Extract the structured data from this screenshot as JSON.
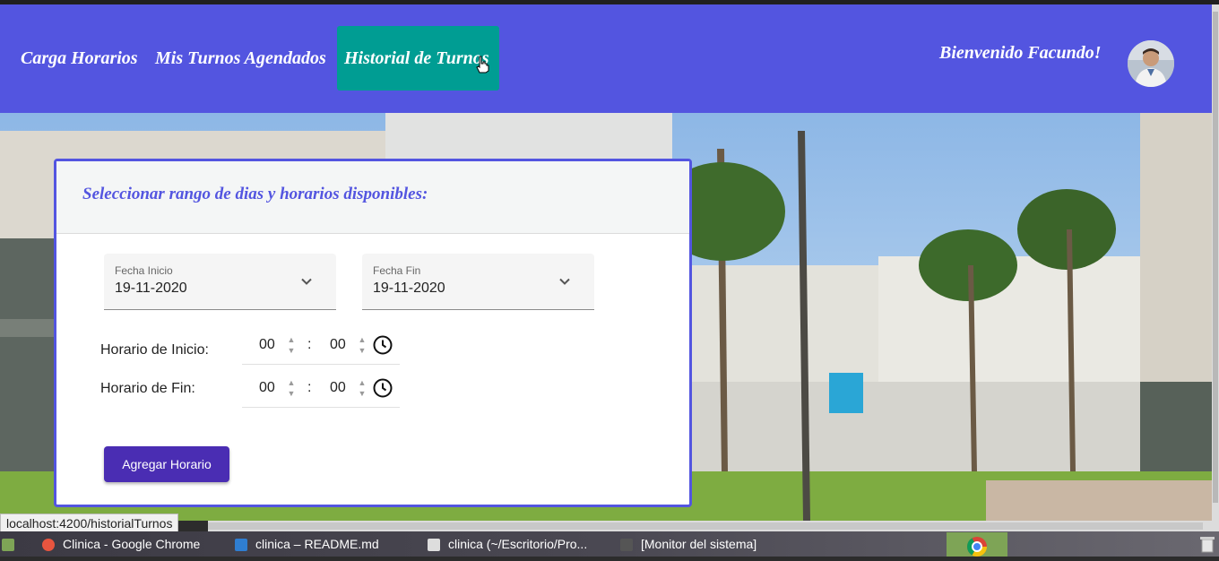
{
  "navbar": {
    "links": [
      "Carga Horarios",
      "Mis Turnos Agendados",
      "Historial de Turnos"
    ],
    "welcome": "Bienvenido Facundo!"
  },
  "panel": {
    "title": "Seleccionar rango de dias y horarios disponibles:",
    "fecha_inicio": {
      "label": "Fecha Inicio",
      "value": "19-11-2020"
    },
    "fecha_fin": {
      "label": "Fecha Fin",
      "value": "19-11-2020"
    },
    "horario_inicio": {
      "label": "Horario de Inicio:",
      "hours": "00",
      "minutes": "00"
    },
    "horario_fin": {
      "label": "Horario de Fin:",
      "hours": "00",
      "minutes": "00"
    },
    "button": "Agregar Horario"
  },
  "status_url": "localhost:4200/historialTurnos",
  "taskbar": {
    "items": [
      "Clinica - Google Chrome",
      "clinica – README.md",
      "clinica (~/Escritorio/Pro...",
      "[Monitor del sistema]"
    ]
  },
  "colors": {
    "navbar": "#5355e0",
    "active_tab": "#009d93",
    "button": "#4a2db3"
  },
  "icons": [
    "chevron-down-icon",
    "clock-icon",
    "chrome-icon",
    "avatar"
  ]
}
